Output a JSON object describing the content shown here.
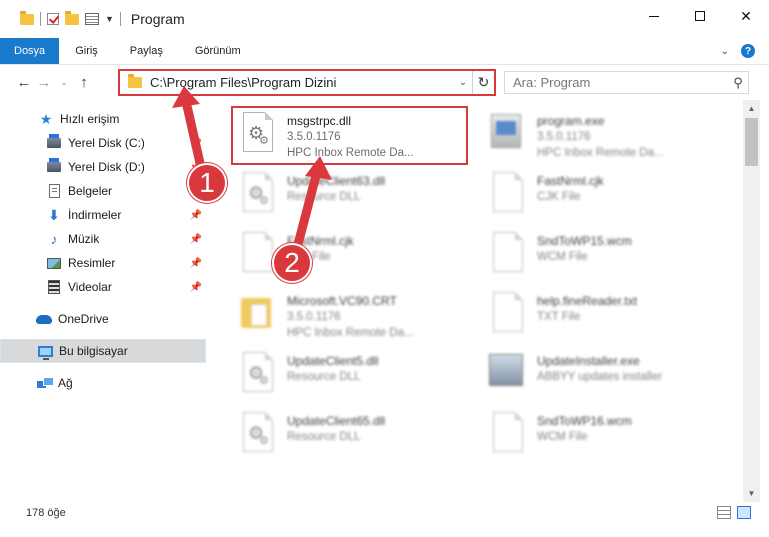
{
  "window": {
    "title": "Program",
    "minimize": "",
    "maximize": "",
    "close": "✕"
  },
  "ribbon": {
    "tabs": [
      "Dosya",
      "Giriş",
      "Paylaş",
      "Görünüm"
    ]
  },
  "nav": {
    "back": "←",
    "forward": "→",
    "recent": "⌄",
    "up": "↑",
    "address": "C:\\Program Files\\Program Dizini",
    "refresh": "↻",
    "search_placeholder": "Ara: Program",
    "search_icon": "⚲"
  },
  "sidebar": {
    "items": [
      {
        "label": "Hızlı erişim",
        "icon": "star-icon",
        "pinned": false
      },
      {
        "label": "Yerel Disk (C:)",
        "icon": "disk-icon",
        "pinned": true
      },
      {
        "label": "Yerel Disk (D:)",
        "icon": "disk-icon",
        "pinned": true
      },
      {
        "label": "Belgeler",
        "icon": "document-icon",
        "pinned": true
      },
      {
        "label": "İndirmeler",
        "icon": "download-icon",
        "pinned": true
      },
      {
        "label": "Müzik",
        "icon": "music-icon",
        "pinned": true
      },
      {
        "label": "Resimler",
        "icon": "pictures-icon",
        "pinned": true
      },
      {
        "label": "Videolar",
        "icon": "videos-icon",
        "pinned": true
      },
      {
        "label": "OneDrive",
        "icon": "cloud-icon",
        "pinned": false
      },
      {
        "label": "Bu bilgisayar",
        "icon": "computer-icon",
        "pinned": false,
        "selected": true
      },
      {
        "label": "Ağ",
        "icon": "network-icon",
        "pinned": false
      }
    ]
  },
  "files": [
    {
      "name": "msgstrpc.dll",
      "line2": "3.5.0.1176",
      "line3": "HPC Inbox Remote Da...",
      "icon": "dll-icon",
      "highlighted": true
    },
    {
      "name": "program.exe",
      "line2": "3.5.0.1176",
      "line3": "HPC Inbox Remote Da...",
      "icon": "exe-icon"
    },
    {
      "name": "UpdateClient63.dll",
      "line2": "Resource DLL",
      "icon": "dll-icon"
    },
    {
      "name": "FastNrml.cjk",
      "line2": "CJK File",
      "icon": "file-icon"
    },
    {
      "name": "FastNrml.cjk",
      "line2": "CJK File",
      "icon": "file-icon"
    },
    {
      "name": "SndToWP15.wcm",
      "line2": "WCM File",
      "icon": "file-icon"
    },
    {
      "name": "Microsoft.VC90.CRT",
      "line2": "3.5.0.1176",
      "line3": "HPC Inbox Remote Da...",
      "icon": "folder-icon"
    },
    {
      "name": "help.fineReader.txt",
      "line2": "TXT File",
      "icon": "file-icon"
    },
    {
      "name": "UpdateClient5.dll",
      "line2": "Resource DLL",
      "icon": "dll-icon"
    },
    {
      "name": "UpdateInstaller.exe",
      "line2": "ABBYY updates installer",
      "icon": "installer-icon"
    },
    {
      "name": "UpdateClient65.dll",
      "line2": "Resource DLL",
      "icon": "dll-icon"
    },
    {
      "name": "SndToWP16.wcm",
      "line2": "WCM File",
      "icon": "file-icon"
    }
  ],
  "annotations": {
    "badge1": "1",
    "badge2": "2",
    "accent": "#d9393d"
  },
  "scrollbar": {
    "up": "▲",
    "down": "▼"
  },
  "status": {
    "count": "178 öğe"
  },
  "colors": {
    "file_tab": "#1979ca",
    "selected_nav": "#d9d9d9",
    "highlight": "#d9393d"
  }
}
